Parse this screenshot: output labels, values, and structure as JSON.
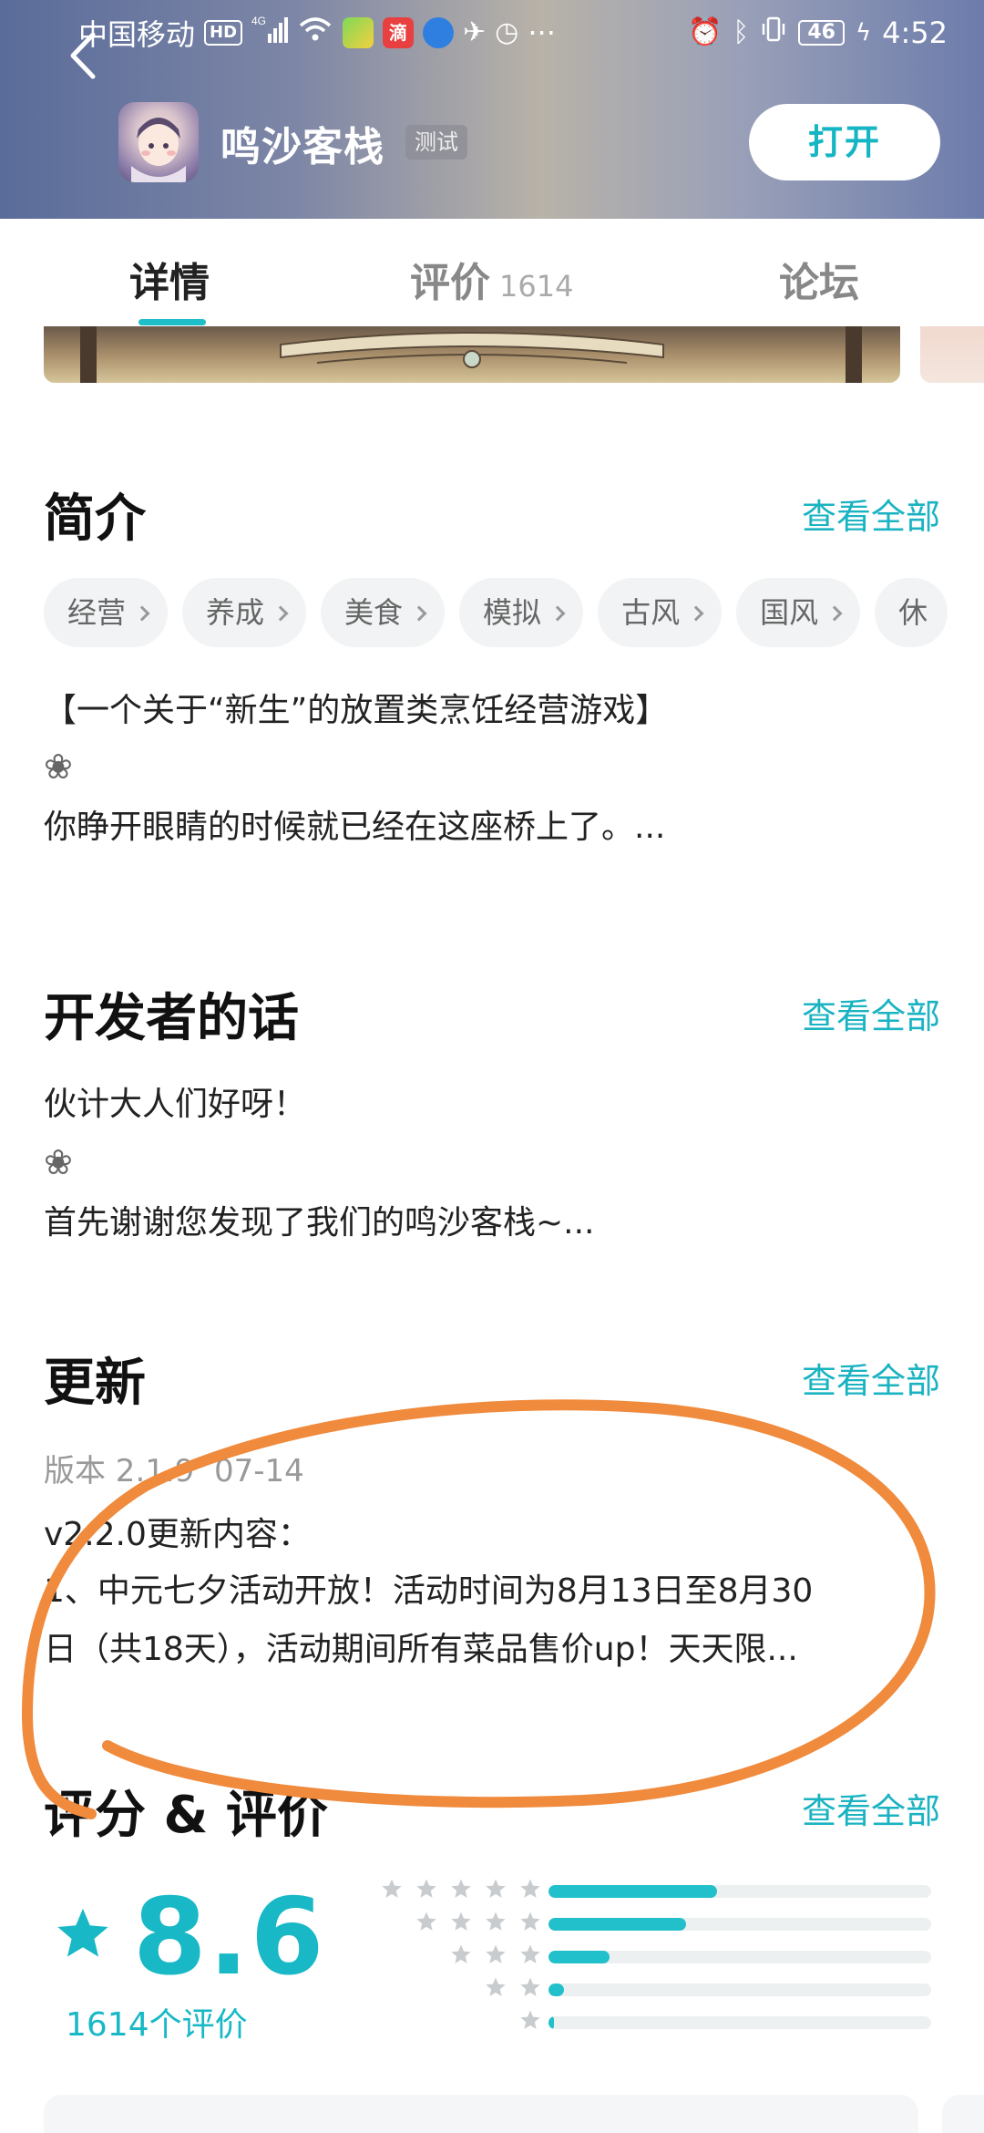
{
  "status_bar": {
    "carrier": "中国移动",
    "hd": "HD",
    "network": "4G",
    "app_badge": "滴",
    "dots": "···",
    "battery": "46",
    "time": "4:52"
  },
  "app": {
    "title": "鸣沙客栈",
    "tag": "测试",
    "open_label": "打开"
  },
  "tabs": [
    {
      "label": "详情",
      "active": true
    },
    {
      "label": "评价",
      "count": "1614"
    },
    {
      "label": "论坛"
    }
  ],
  "see_all": "查看全部",
  "intro": {
    "title": "简介",
    "tags": [
      "经营",
      "养成",
      "美食",
      "模拟",
      "古风",
      "国风",
      "休"
    ],
    "line1": "【一个关于“新生”的放置类烹饪经营游戏】",
    "line2": "你睁开眼睛的时候就已经在这座桥上了。..."
  },
  "developer": {
    "title": "开发者的话",
    "line1": "伙计大人们好呀！",
    "line2": "首先谢谢您发现了我们的鸣沙客栈~..."
  },
  "update": {
    "title": "更新",
    "version": "版本 2.1.9",
    "version_date": "07-14",
    "line1": "v2.2.0更新内容：",
    "line2": "1、中元七夕活动开放！活动时间为8月13日至8月30",
    "line3": "日（共18天），活动期间所有菜品售价up！天天限..."
  },
  "ratings": {
    "title": "评分 & 评价",
    "score": "8.6",
    "count_label": "1614个评价",
    "distribution": [
      {
        "stars": 5,
        "fraction": 0.44
      },
      {
        "stars": 4,
        "fraction": 0.36
      },
      {
        "stars": 3,
        "fraction": 0.16
      },
      {
        "stars": 2,
        "fraction": 0.04
      },
      {
        "stars": 1,
        "fraction": 0.015
      }
    ]
  },
  "colors": {
    "accent": "#1ab3c2",
    "annotation": "#f08a3c"
  }
}
